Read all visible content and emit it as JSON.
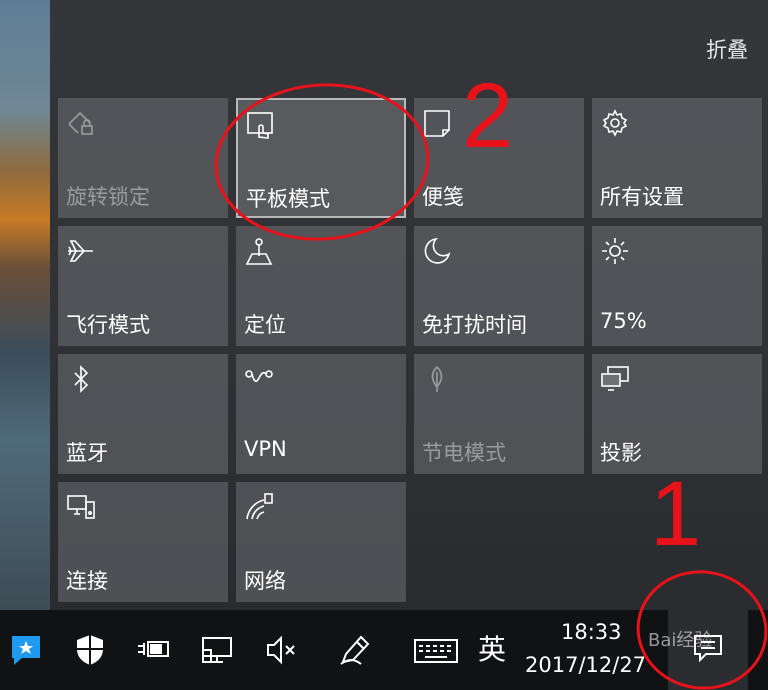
{
  "action_center": {
    "collapse_label": "折叠",
    "tiles": [
      {
        "label": "旋转锁定",
        "icon": "rotation-lock-icon",
        "state": "disabled"
      },
      {
        "label": "平板模式",
        "icon": "tablet-mode-icon",
        "state": "highlighted"
      },
      {
        "label": "便笺",
        "icon": "note-icon",
        "state": "normal"
      },
      {
        "label": "所有设置",
        "icon": "gear-icon",
        "state": "normal"
      },
      {
        "label": "飞行模式",
        "icon": "airplane-icon",
        "state": "normal"
      },
      {
        "label": "定位",
        "icon": "location-icon",
        "state": "normal"
      },
      {
        "label": "免打扰时间",
        "icon": "moon-icon",
        "state": "normal"
      },
      {
        "label": "75%",
        "icon": "brightness-icon",
        "state": "normal"
      },
      {
        "label": "蓝牙",
        "icon": "bluetooth-icon",
        "state": "normal"
      },
      {
        "label": "VPN",
        "icon": "vpn-icon",
        "state": "normal"
      },
      {
        "label": "节电模式",
        "icon": "battery-saver-icon",
        "state": "disabled"
      },
      {
        "label": "投影",
        "icon": "project-icon",
        "state": "normal"
      },
      {
        "label": "连接",
        "icon": "connect-icon",
        "state": "normal"
      },
      {
        "label": "网络",
        "icon": "network-icon",
        "state": "normal"
      }
    ]
  },
  "taskbar": {
    "ime_label": "英",
    "time": "18:33",
    "date": "2017/12/27",
    "icons": [
      "app-icon",
      "shield-icon",
      "power-plug-icon",
      "network-monitor-icon",
      "volume-mute-icon",
      "pen-icon",
      "keyboard-icon",
      "action-center-icon"
    ]
  },
  "annotations": {
    "marker_1": "1",
    "marker_2": "2",
    "color": "#e8121a"
  },
  "watermark": "Bai经验"
}
